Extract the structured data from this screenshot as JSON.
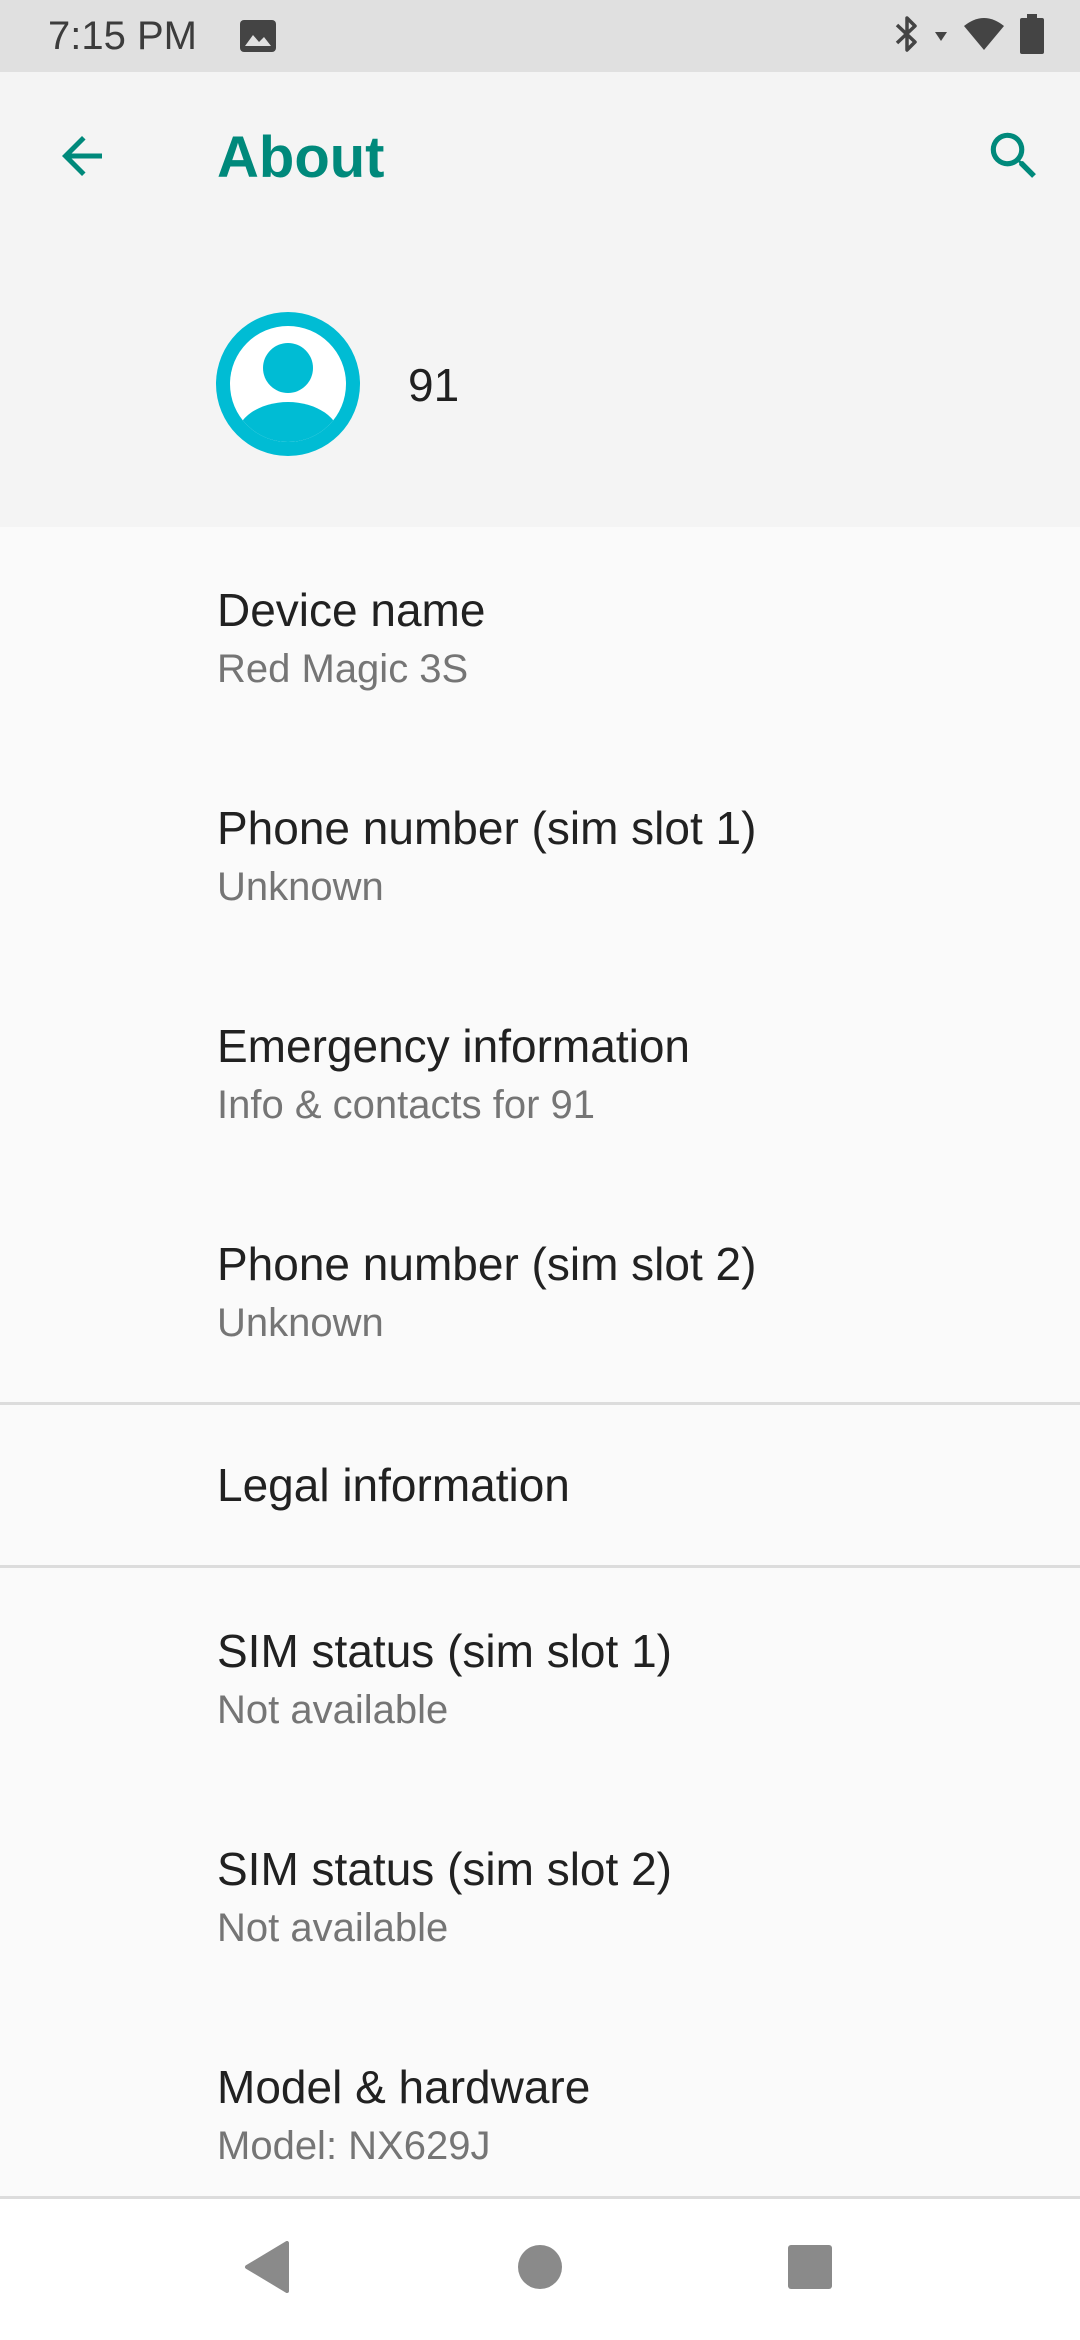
{
  "status_bar": {
    "time": "7:15 PM",
    "icons": [
      "image-icon",
      "bluetooth-icon",
      "data-arrows-icon",
      "wifi-icon",
      "battery-icon"
    ]
  },
  "header": {
    "title": "About",
    "back_icon": "arrow-back-icon",
    "search_icon": "search-icon",
    "user_name": "91",
    "accent_color": "#00897b",
    "avatar_color": "#00bcd4"
  },
  "list": {
    "items": [
      {
        "title": "Device name",
        "subtitle": "Red Magic 3S"
      },
      {
        "title": "Phone number (sim slot 1)",
        "subtitle": "Unknown"
      },
      {
        "title": "Emergency information",
        "subtitle": "Info & contacts for 91"
      },
      {
        "title": "Phone number (sim slot 2)",
        "subtitle": "Unknown"
      },
      {
        "title": "Legal information"
      },
      {
        "title": "SIM status (sim slot 1)",
        "subtitle": "Not available"
      },
      {
        "title": "SIM status (sim slot 2)",
        "subtitle": "Not available"
      },
      {
        "title": "Model & hardware",
        "subtitle": "Model: NX629J"
      }
    ]
  },
  "nav_bar": {
    "icons": [
      "back-triangle-icon",
      "home-circle-icon",
      "recents-square-icon"
    ]
  }
}
